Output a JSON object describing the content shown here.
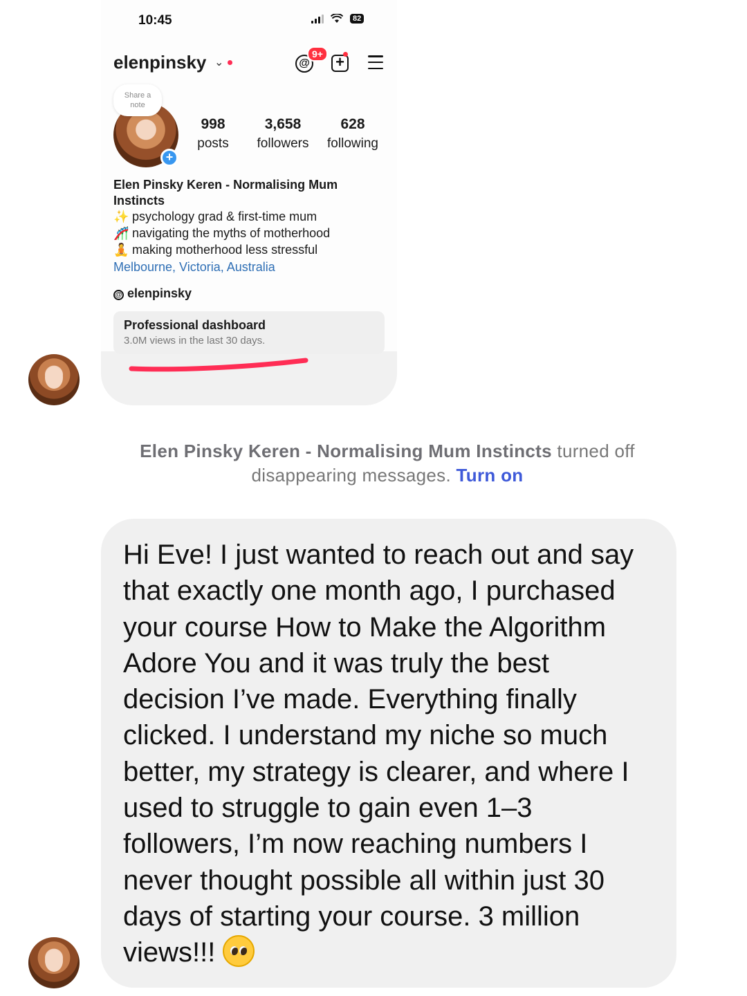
{
  "screenshot": {
    "status_time": "10:45",
    "battery": "82",
    "username": "elenpinsky",
    "notif_count": "9+",
    "note_label": "Share a note",
    "stats": [
      {
        "num": "998",
        "label": "posts"
      },
      {
        "num": "3,658",
        "label": "followers"
      },
      {
        "num": "628",
        "label": "following"
      }
    ],
    "full_name": "Elen Pinsky Keren - Normalising Mum Instincts",
    "bio": [
      {
        "emoji": "✨",
        "text": "psychology grad & first-time mum"
      },
      {
        "emoji": "🎢",
        "text": "navigating the myths of motherhood"
      },
      {
        "emoji": "🧘",
        "text": "making motherhood less stressful"
      }
    ],
    "location": "Melbourne, Victoria, Australia",
    "threads_handle": "elenpinsky",
    "dashboard_title": "Professional dashboard",
    "dashboard_sub": "3.0M views in the last 30 days.",
    "highlight_color": "#ff2d55"
  },
  "system_message": {
    "name": "Elen Pinsky Keren - Normalising Mum Instincts",
    "text": " turned off disappearing messages. ",
    "link": "Turn on"
  },
  "message": {
    "text": "Hi Eve! I just wanted to reach out and say that exactly one month ago, I purchased your course How to Make the Algorithm Adore You and it was truly the best decision I’ve made. Everything finally clicked. I understand my niche so much better, my strategy is clearer, and where I used to struggle to gain even 1–3 followers, I’m now reaching numbers I never thought possible all within just 30 days of starting your course. 3 million views!!! ",
    "emoji": "pleading-face-icon"
  }
}
